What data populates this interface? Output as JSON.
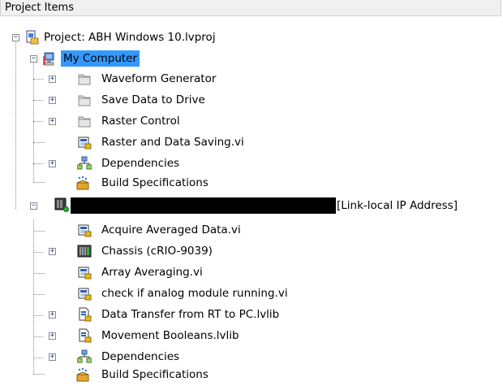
{
  "panel": {
    "title": "Project Items"
  },
  "tree": {
    "project": {
      "label": "Project: ABH Windows 10.lvproj"
    },
    "my_computer": {
      "label": "My Computer",
      "children": [
        {
          "label": "Waveform Generator",
          "icon": "folder-icon"
        },
        {
          "label": "Save Data to Drive",
          "icon": "folder-icon"
        },
        {
          "label": "Raster Control",
          "icon": "folder-icon"
        },
        {
          "label": "Raster and Data Saving.vi",
          "icon": "vi-icon"
        },
        {
          "label": "Dependencies",
          "icon": "dependencies-icon"
        },
        {
          "label": "Build Specifications",
          "icon": "build-specifications-icon"
        }
      ]
    },
    "target": {
      "label_suffix": "[Link-local IP Address]",
      "children": [
        {
          "label": "Acquire Averaged Data.vi",
          "icon": "vi-icon"
        },
        {
          "label": "Chassis (cRIO-9039)",
          "icon": "chassis-icon"
        },
        {
          "label": "Array Averaging.vi",
          "icon": "vi-icon"
        },
        {
          "label": "check if analog module running.vi",
          "icon": "vi-icon"
        },
        {
          "label": "Data Transfer from RT to PC.lvlib",
          "icon": "library-icon"
        },
        {
          "label": "Movement Booleans.lvlib",
          "icon": "library-icon"
        },
        {
          "label": "Dependencies",
          "icon": "dependencies-icon"
        },
        {
          "label": "Build Specifications",
          "icon": "build-specifications-icon"
        }
      ]
    }
  }
}
